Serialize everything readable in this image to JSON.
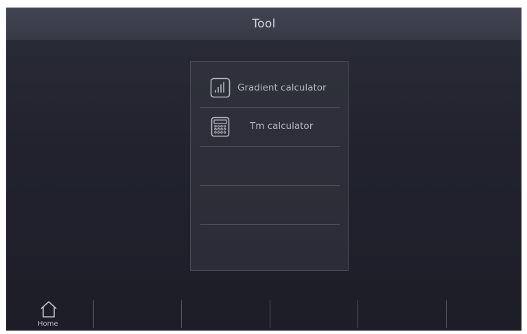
{
  "header": {
    "title": "Tool"
  },
  "tools": {
    "items": [
      {
        "label": "Gradient calculator",
        "icon": "bar-chart-icon"
      },
      {
        "label": "Tm calculator",
        "icon": "calculator-icon"
      },
      {
        "label": "",
        "icon": ""
      },
      {
        "label": "",
        "icon": ""
      }
    ]
  },
  "bottom_nav": {
    "home_label": "Home",
    "home_icon": "home-icon"
  },
  "colors": {
    "background": "#22232f",
    "titlebar": "#3c3e4b",
    "panel": "#2d2e39",
    "text": "#b7b8c2",
    "divider": "#4f505d"
  }
}
